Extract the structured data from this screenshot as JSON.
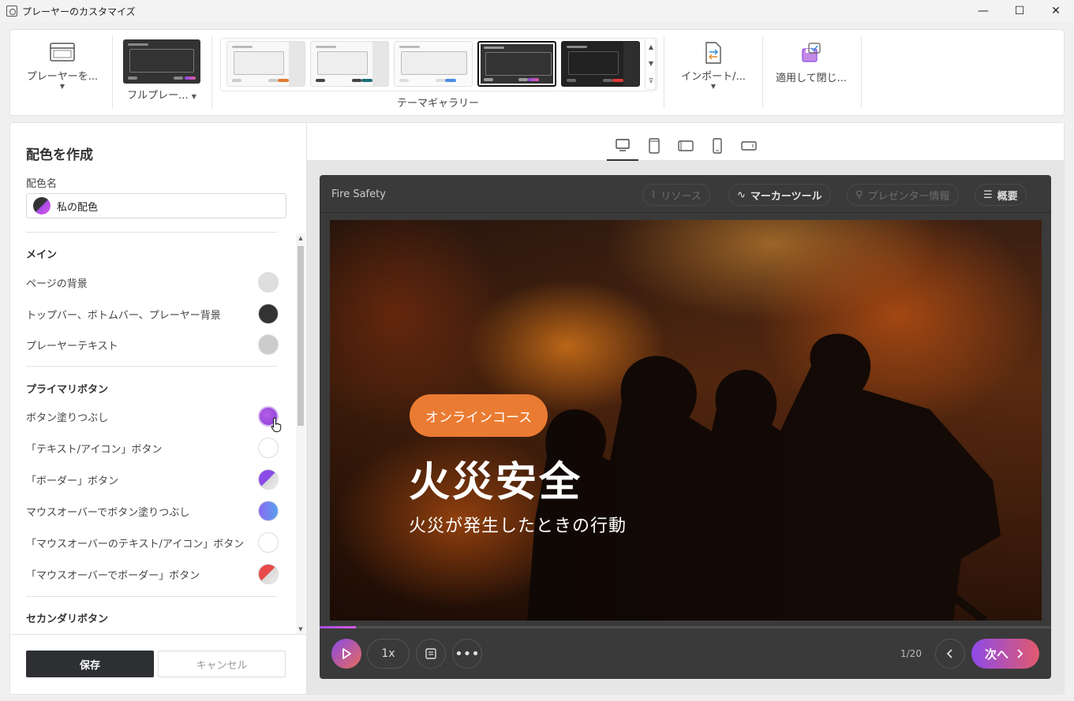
{
  "window": {
    "title": "プレーヤーのカスタマイズ",
    "minimize": "—",
    "maximize": "☐",
    "close": "✕"
  },
  "ribbon": {
    "player_label": "プレーヤーを...",
    "fullplayer_label": "フルプレー...",
    "gallery_label": "テーマギャラリー",
    "import_label": "インポート/...",
    "apply_label": "適用して閉じ...",
    "themes": [
      {
        "name": "light-orange",
        "accent": "#e07a30"
      },
      {
        "name": "light-teal",
        "accent": "#1f6e78"
      },
      {
        "name": "light-blue",
        "accent": "#4a8ee6"
      },
      {
        "name": "dark-purple",
        "accent": "#b04ee6"
      },
      {
        "name": "dark-red",
        "accent": "#e03a3a"
      }
    ]
  },
  "panel": {
    "title": "配色を作成",
    "name_label": "配色名",
    "name_value": "私の配色",
    "sections": {
      "main": "メイン",
      "primary": "プライマリボタン",
      "secondary": "セカンダリボタン"
    },
    "rows": {
      "page_bg": "ページの背景",
      "bars_bg": "トップバー、ボトムバー、プレーヤー背景",
      "player_text": "プレーヤーテキスト",
      "btn_fill": "ボタン塗りつぶし",
      "btn_text": "「テキスト/アイコン」ボタン",
      "btn_border": "「ボーダー」ボタン",
      "hover_fill": "マウスオーバーでボタン塗りつぶし",
      "hover_text": "「マウスオーバーのテキスト/アイコン」ボタン",
      "hover_border": "「マウスオーバーでボーダー」ボタン"
    },
    "colors": {
      "page_bg": "#dedede",
      "bars_bg": "#333333",
      "player_text": "#cccccc",
      "btn_fill": "#a84be6",
      "btn_text": "#ffffff",
      "hover_fill": "#6b7cf0"
    },
    "save": "保存",
    "cancel": "キャンセル"
  },
  "player": {
    "course_title": "Fire Safety",
    "tabs": {
      "resources": "リソース",
      "marker": "マーカーツール",
      "presenter": "プレゼンター情報",
      "outline": "概要"
    },
    "slide": {
      "pill": "オンラインコース",
      "title": "火災安全",
      "subtitle": "火災が発生したときの行動"
    },
    "speed": "1x",
    "page": "1/20",
    "next": "次へ",
    "progress": 0.05
  }
}
